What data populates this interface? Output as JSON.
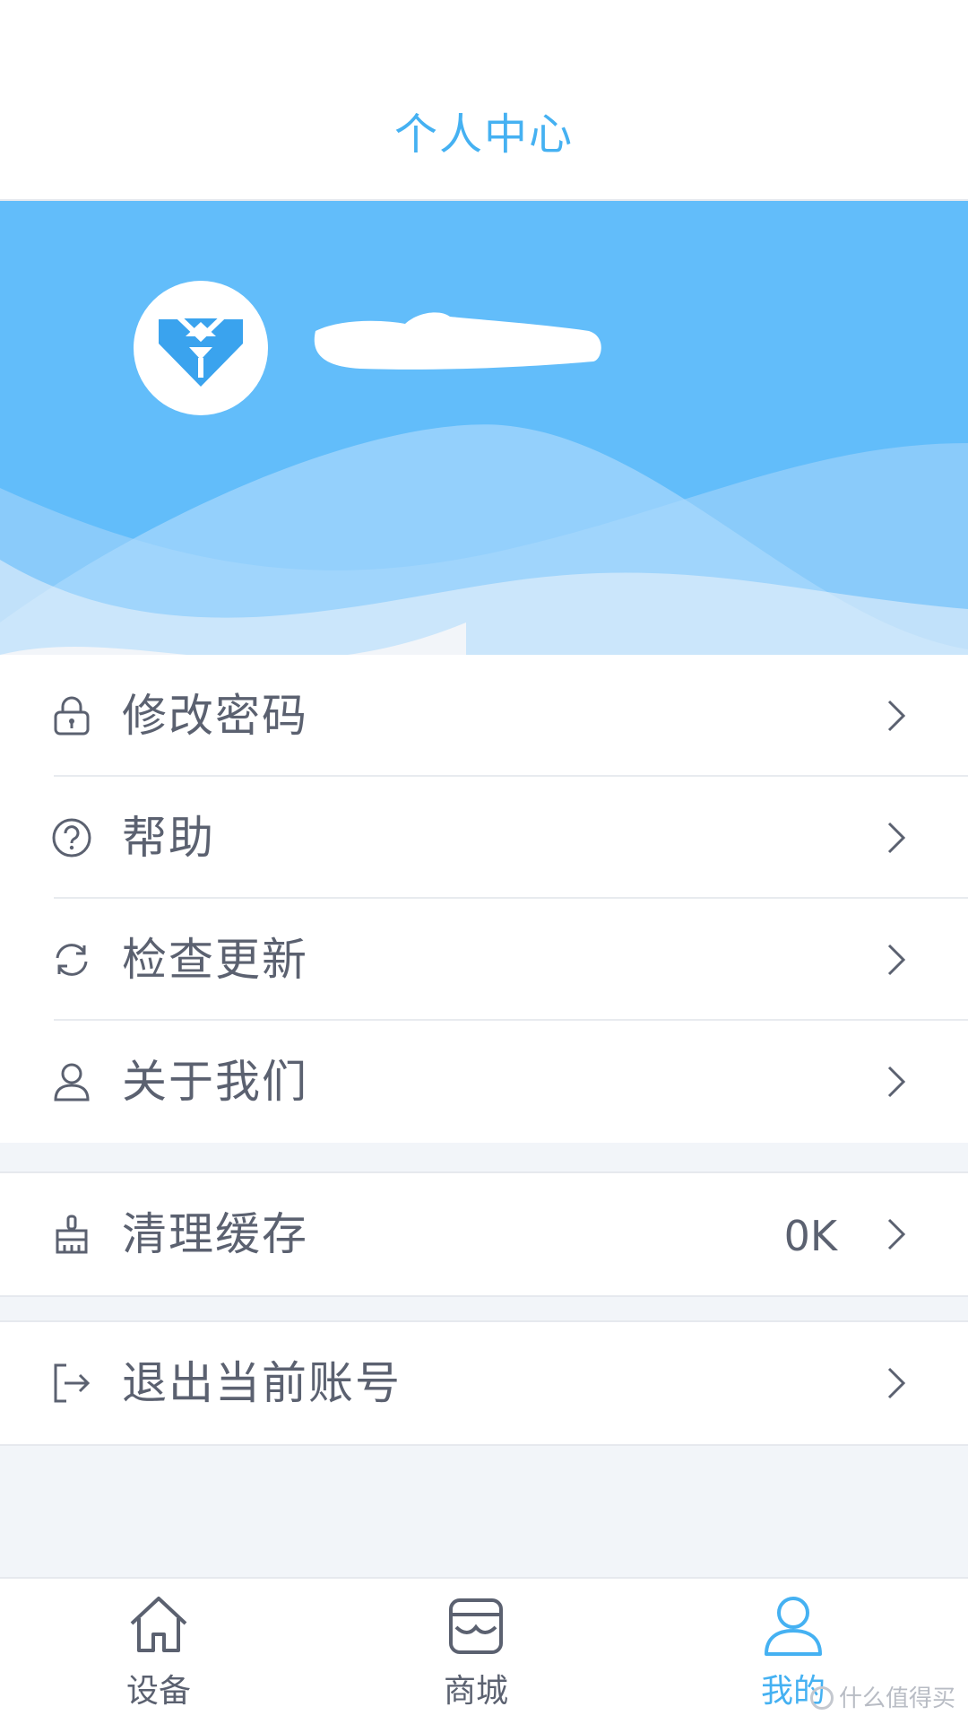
{
  "header": {
    "title": "个人中心"
  },
  "profile": {
    "avatar_icon": "app-logo-icon",
    "username": ""
  },
  "menu": {
    "change_password": {
      "label": "修改密码",
      "icon": "lock-icon"
    },
    "help": {
      "label": "帮助",
      "icon": "question-circle-icon"
    },
    "check_update": {
      "label": "检查更新",
      "icon": "refresh-icon"
    },
    "about_us": {
      "label": "关于我们",
      "icon": "user-icon"
    },
    "clear_cache": {
      "label": "清理缓存",
      "value": "0K",
      "icon": "broom-icon"
    },
    "logout": {
      "label": "退出当前账号",
      "icon": "logout-icon"
    }
  },
  "tabbar": {
    "tabs": [
      {
        "label": "设备",
        "icon": "home-icon",
        "active": false
      },
      {
        "label": "商城",
        "icon": "store-icon",
        "active": false
      },
      {
        "label": "我的",
        "icon": "user-icon",
        "active": true
      }
    ]
  },
  "watermark": "什么值得买",
  "colors": {
    "accent": "#45b1f2",
    "banner": "#62bdfa",
    "text": "#5b6170",
    "background": "#f2f5f9"
  }
}
